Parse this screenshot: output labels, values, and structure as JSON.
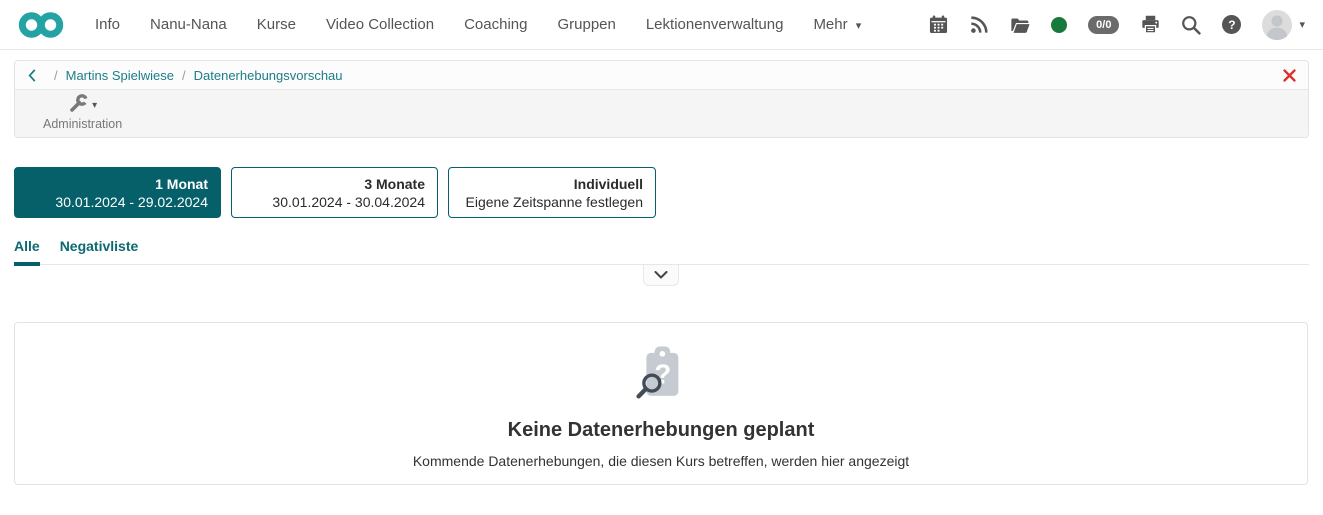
{
  "navbar": {
    "menu": [
      {
        "label": "Info"
      },
      {
        "label": "Nanu-Nana"
      },
      {
        "label": "Kurse"
      },
      {
        "label": "Video Collection"
      },
      {
        "label": "Coaching"
      },
      {
        "label": "Gruppen"
      },
      {
        "label": "Lektionenverwaltung"
      },
      {
        "label": "Mehr"
      }
    ],
    "more_caret": "▾",
    "status_badge": "0/0",
    "help_glyph": "?",
    "avatar_caret": "▾"
  },
  "breadcrumb": {
    "course": "Martins Spielwiese",
    "page": "Datenerhebungsvorschau",
    "separator": "/"
  },
  "toolbar": {
    "administration_label": "Administration",
    "caret": "▾"
  },
  "range_buttons": {
    "one_month": {
      "title": "1 Monat",
      "subtitle": "30.01.2024 - 29.02.2024"
    },
    "three_months": {
      "title": "3 Monate",
      "subtitle": "30.01.2024 - 30.04.2024"
    },
    "custom": {
      "title": "Individuell",
      "subtitle": "Eigene Zeitspanne festlegen"
    }
  },
  "tabs": {
    "all": "Alle",
    "negative": "Negativliste"
  },
  "empty_state": {
    "title": "Keine Datenerhebungen geplant",
    "subtitle": "Kommende Datenerhebungen, die diesen Kurs betreffen, werden hier angezeigt"
  },
  "colors": {
    "brand_teal": "#24A3A4",
    "selected_teal": "#066069",
    "link_teal": "#1C7D87",
    "tab_teal": "#0D6974",
    "status_green": "#17793C",
    "close_red": "#D9302C",
    "icon_gray": "#555555",
    "empty_icon_gray": "#C6CBD1",
    "magnifier_slate": "#414C57"
  }
}
